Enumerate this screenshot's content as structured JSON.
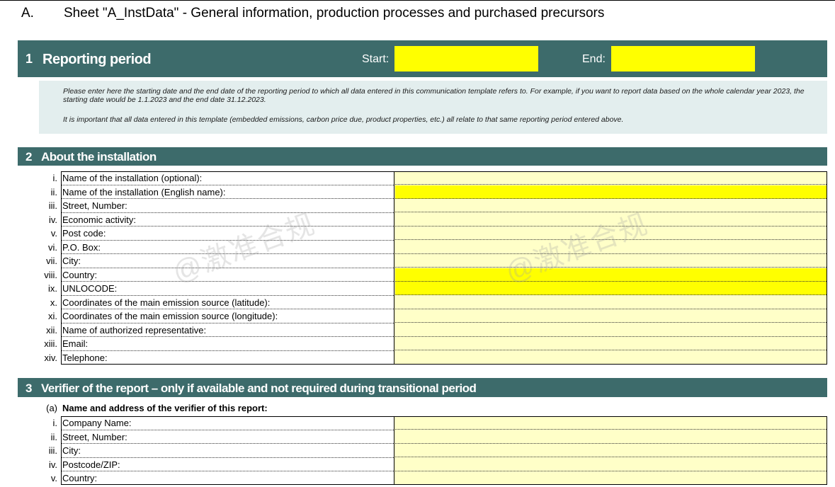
{
  "sheet": {
    "letter": "A.",
    "title": "Sheet \"A_InstData\" - General information, production processes and purchased precursors"
  },
  "section1": {
    "number": "1",
    "title": "Reporting period",
    "start_label": "Start:",
    "start_value": "",
    "end_label": "End:",
    "end_value": "",
    "info_p1": "Please enter here the starting date and the end date of the reporting period to which all data entered in this communication template refers to. For example, if you want to report data based on the whole calendar year 2023, the starting date would be 1.1.2023 and the end date 31.12.2023.",
    "info_p2": "It is important that all data entered in this template (embedded emissions, carbon price due, product properties, etc.) all relate to that same reporting period entered above."
  },
  "section2": {
    "number": "2",
    "title": "About the installation",
    "rows": [
      {
        "num": "i.",
        "label": "Name of the installation (optional):",
        "value": ""
      },
      {
        "num": "ii.",
        "label": "Name of the installation (English name):",
        "value": ""
      },
      {
        "num": "iii.",
        "label": "Street, Number:",
        "value": ""
      },
      {
        "num": "iv.",
        "label": "Economic activity:",
        "value": ""
      },
      {
        "num": "v.",
        "label": "Post code:",
        "value": ""
      },
      {
        "num": "vi.",
        "label": "P.O. Box:",
        "value": ""
      },
      {
        "num": "vii.",
        "label": "City:",
        "value": ""
      },
      {
        "num": "viii.",
        "label": "Country:",
        "value": ""
      },
      {
        "num": "ix.",
        "label": "UNLOCODE:",
        "value": ""
      },
      {
        "num": "x.",
        "label": "Coordinates of the main emission source (latitude):",
        "value": ""
      },
      {
        "num": "xi.",
        "label": "Coordinates of the main emission source (longitude):",
        "value": ""
      },
      {
        "num": "xii.",
        "label": "Name of authorized representative:",
        "value": ""
      },
      {
        "num": "xiii.",
        "label": "Email:",
        "value": ""
      },
      {
        "num": "xiv.",
        "label": "Telephone:",
        "value": ""
      }
    ]
  },
  "section3": {
    "number": "3",
    "title": "Verifier of the report – only if available and not required during transitional period",
    "sub_num": "(a)",
    "sub_label": "Name and address of the verifier of this report:",
    "rows": [
      {
        "num": "i.",
        "label": "Company Name:",
        "value": ""
      },
      {
        "num": "ii.",
        "label": "Street, Number:",
        "value": ""
      },
      {
        "num": "iii.",
        "label": "City:",
        "value": ""
      },
      {
        "num": "iv.",
        "label": "Postcode/ZIP:",
        "value": ""
      },
      {
        "num": "v.",
        "label": "Country:",
        "value": ""
      }
    ]
  },
  "watermark": "@激准合规",
  "colors": {
    "header_bar": "#3d6b6b",
    "required_input": "#ffff00",
    "optional_input": "#ffffc8",
    "info_box": "#e3eeee"
  }
}
